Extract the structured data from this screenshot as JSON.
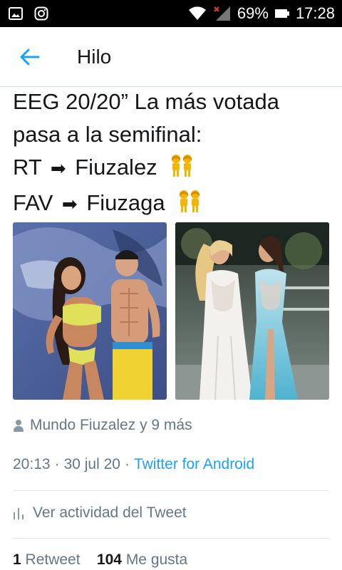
{
  "status_bar": {
    "battery": "69%",
    "time": "17:28",
    "icons": [
      "gallery-icon",
      "instagram-icon",
      "wifi-icon",
      "signal-icon",
      "battery-icon"
    ]
  },
  "header": {
    "title": "Hilo",
    "back_icon": "arrow-left-icon"
  },
  "tweet": {
    "lines": [
      "EEG 20/20” La más votada",
      "pasa a la semifinal:",
      "RT",
      "Fiuzalez",
      "FAV",
      "Fiuzaga"
    ],
    "images": [
      {
        "name": "photo-couple-beach"
      },
      {
        "name": "photo-two-women-dresses"
      }
    ],
    "retweeted_by": "Mundo Fiuzalez y 9 más",
    "time": "20:13",
    "date": "30 jul 20",
    "source": "Twitter for Android",
    "activity_label": "Ver actividad del Tweet",
    "retweet_count": "1",
    "retweet_label": "Retweet",
    "like_count": "104",
    "like_label": "Me gusta"
  },
  "colors": {
    "accent": "#1da1f2",
    "secondary_text": "#657786",
    "divider": "#e1e8ed"
  }
}
